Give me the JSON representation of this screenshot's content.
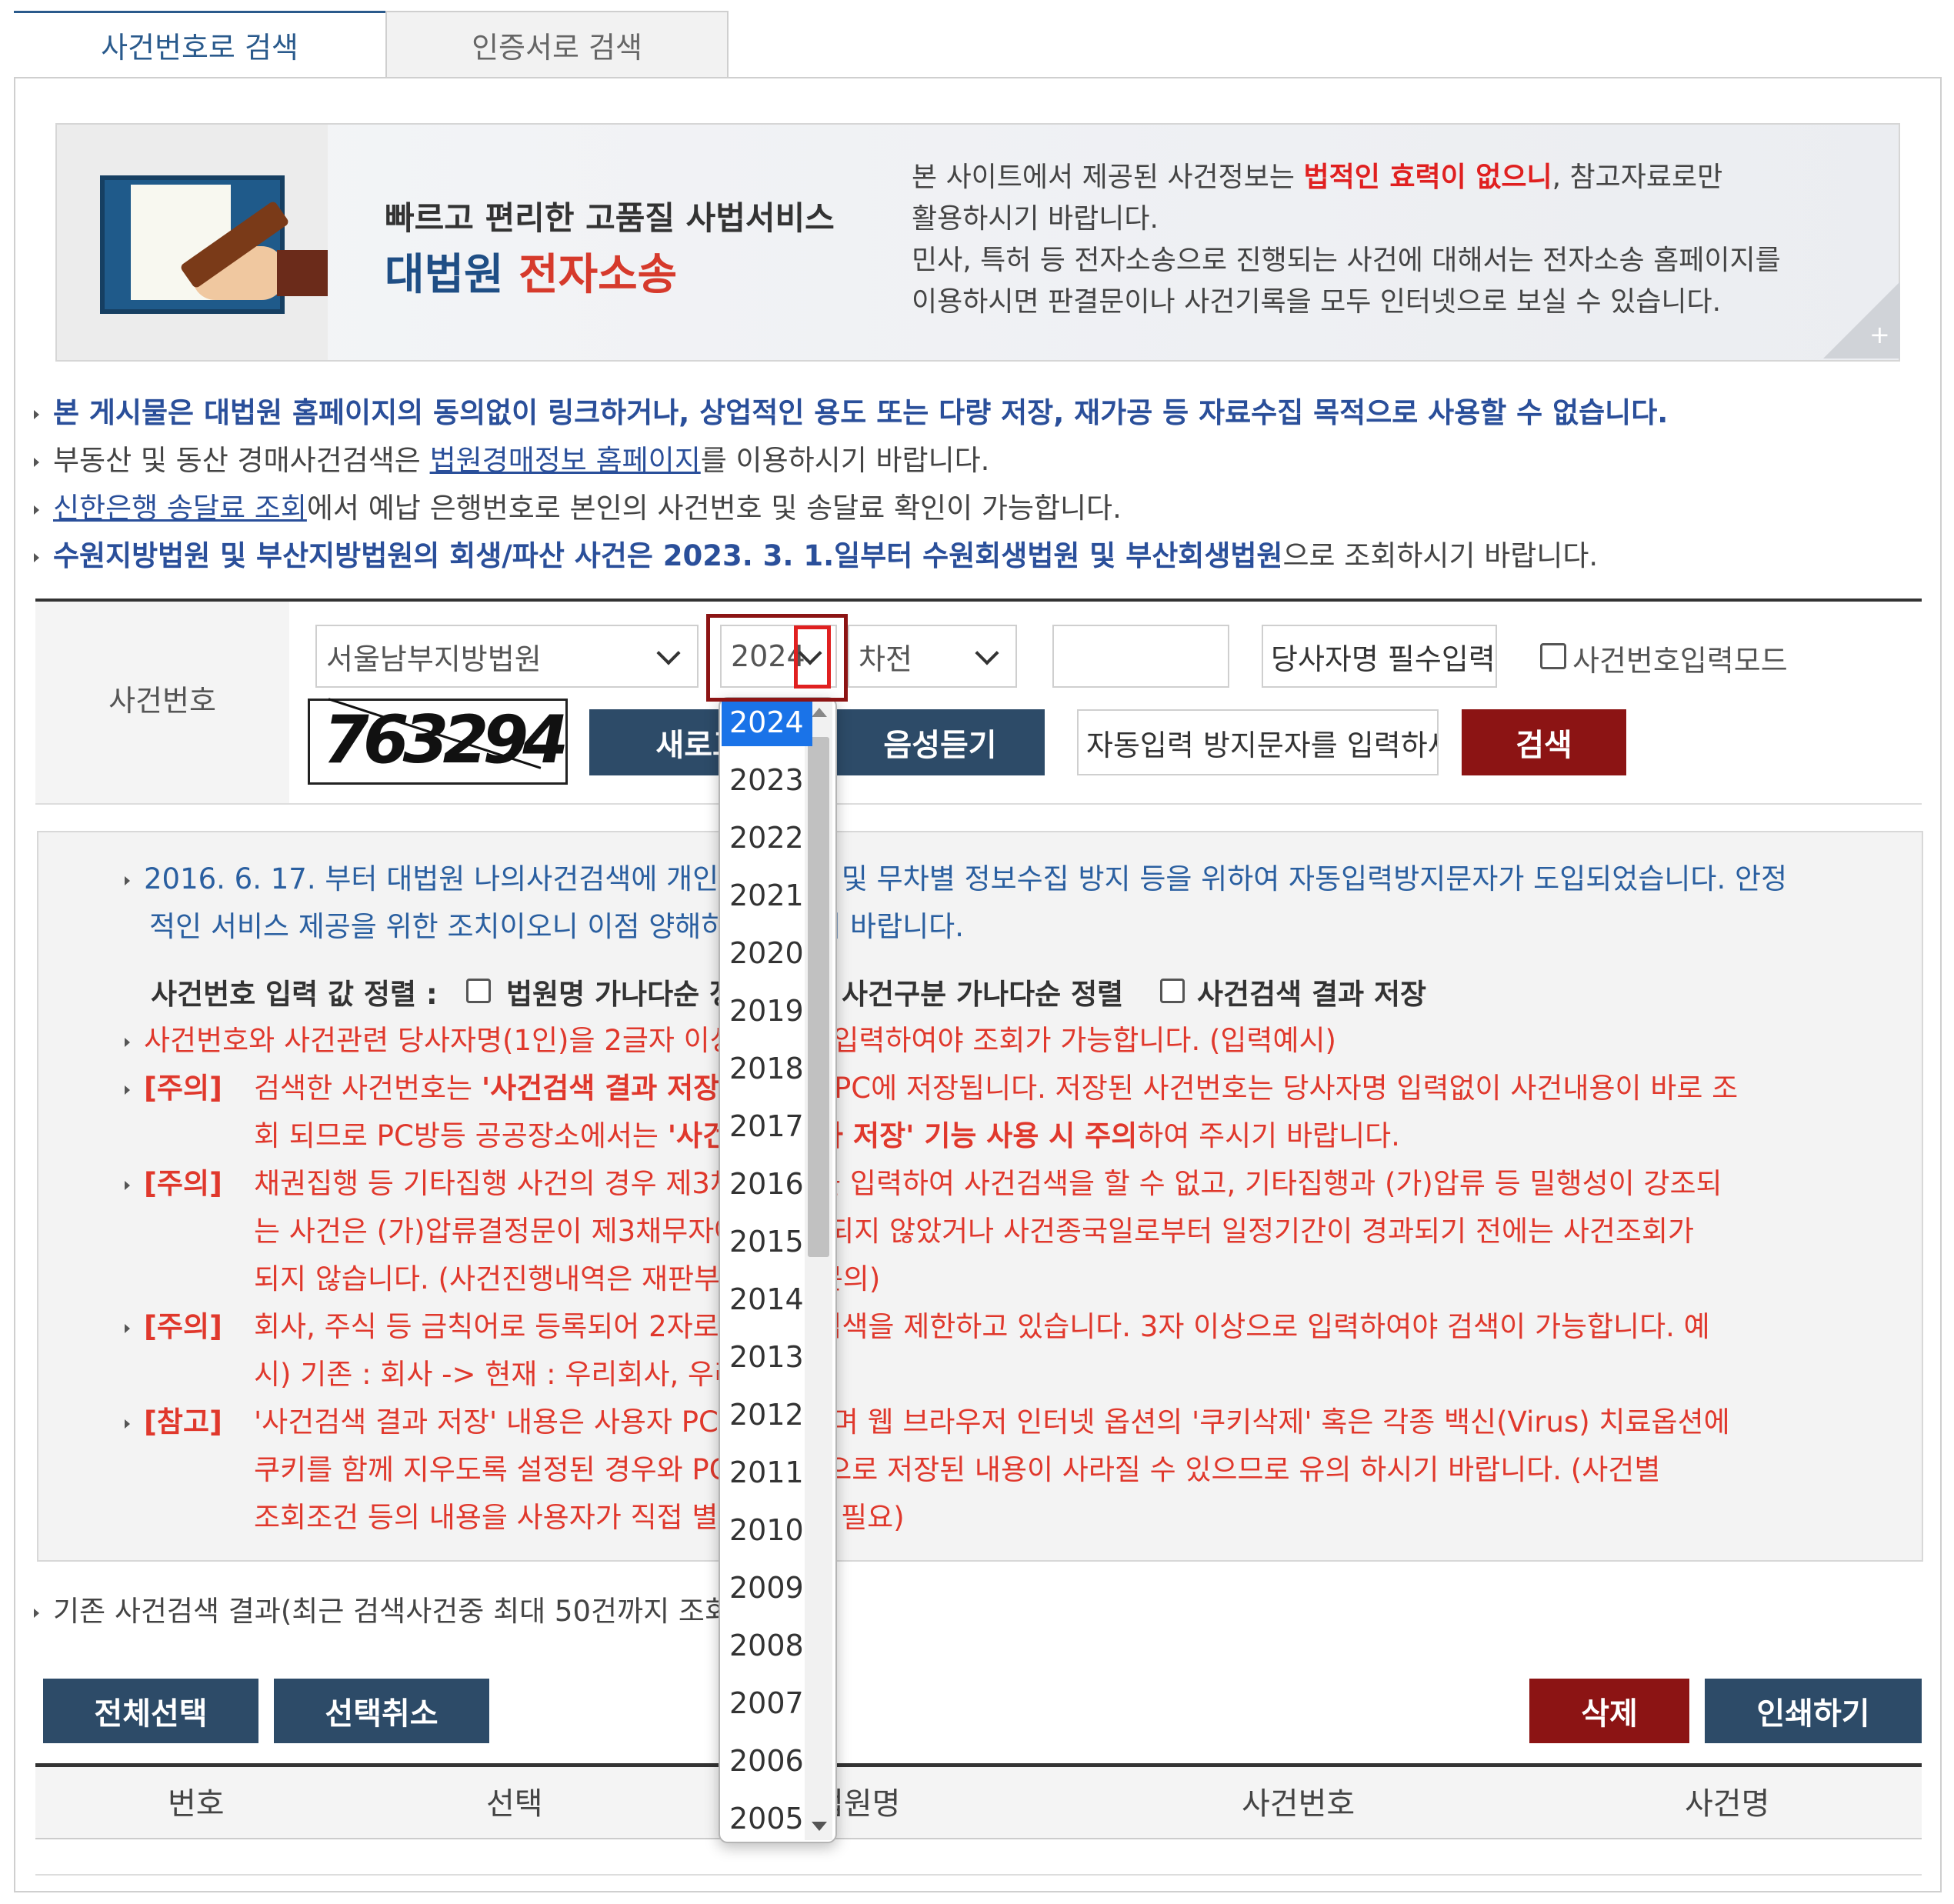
{
  "tabs": {
    "active": "사건번호로 검색",
    "inactive": "인증서로 검색"
  },
  "banner": {
    "title_line1": "빠르고 편리한 고품질 사법서비스",
    "title_main": "대법원",
    "title_red": "전자소송",
    "text_a": "본 사이트에서 제공된 사건정보는 ",
    "text_hl": "법적인 효력이 없으니",
    "text_b": ", 참고자료로만",
    "text_line2": "활용하시기 바랍니다.",
    "text_line3": "민사, 특허 등 전자소송으로 진행되는 사건에 대해서는 전자소송 홈페이지를",
    "text_line4": "이용하시면 판결문이나 사건기록을 모두 인터넷으로 보실 수 있습니다.",
    "plus": "+"
  },
  "notices": {
    "n1": "본 게시물은 대법원 홈페이지의 동의없이 링크하거나, 상업적인 용도 또는 다량 저장, 재가공 등 자료수집 목적으로 사용할 수 없습니다.",
    "n2_a": "부동산 및 동산 경매사건검색은 ",
    "n2_link": "법원경매정보 홈페이지",
    "n2_b": "를 이용하시기 바랍니다.",
    "n3_link": "신한은행 송달료 조회",
    "n3_b": "에서 예납 은행번호로 본인의 사건번호 및 송달료 확인이 가능합니다.",
    "n4_a": "수원지방법원 및 부산지방법원의 회생/파산 사건은 2023. 3. 1.일부터 수원회생법원 및 부산회생법원",
    "n4_b": "으로 조회하시기 바랍니다."
  },
  "search": {
    "label": "사건번호",
    "court": "서울남부지방법원",
    "year": "2024",
    "case_type": "차전",
    "case_number": "",
    "party_placeholder": "당사자명 필수입력",
    "input_mode_label": "사건번호입력모드",
    "captcha_text": "763294",
    "refresh_btn": "새로고침",
    "audio_btn": "음성듣기",
    "captcha_placeholder": "자동입력 방지문자를 입력하세요",
    "search_btn": "검색"
  },
  "year_options": [
    "2024",
    "2023",
    "2022",
    "2021",
    "2020",
    "2019",
    "2018",
    "2017",
    "2016",
    "2015",
    "2014",
    "2013",
    "2012",
    "2011",
    "2010",
    "2009",
    "2008",
    "2007",
    "2006",
    "2005"
  ],
  "info": {
    "l1": "2016. 6. 17. 부터 대법원 나의사건검색에 개인정보 보호 및 무차별 정보수집 방지 등을 위하여 자동입력방지문자가 도입되었습니다. 안정",
    "l2": "적인 서비스 제공을 위한 조치이오니 이점 양해하여 주시기 바랍니다.",
    "sort_label": "사건번호 입력 값 정렬 :",
    "sort_opt1": "법원명 가나다순 정렬",
    "sort_opt2": "사건구분 가나다순 정렬",
    "sort_opt3": "사건검색 결과 저장",
    "r1": "사건번호와 사건관련 당사자명(1인)을 2글자 이상 정확히 입력하여야 조회가 가능합니다. (입력예시)",
    "tag_caution": "[주의]",
    "tag_note": "[참고]",
    "c1_a": "검색한 사건번호는 ",
    "c1_b": "'사건검색 결과 저장'",
    "c1_c": " 선택 시 PC에 저장됩니다. 저장된 사건번호는 당사자명 입력없이 사건내용이 바로 조",
    "c1_d": "회 되므로 PC방등 공공장소에서는 ",
    "c1_e": "'사건검색 결과 저장' 기능 사용 시 주의",
    "c1_f": "하여 주시기 바랍니다.",
    "c2_a": "채권집행 등 기타집행 사건의 경우 제3채무자명을 입력하여 사건검색을 할 수 없고, 기타집행과 (가)압류 등 밀행성이 강조되",
    "c2_b": "는 사건은 (가)압류결정문이 제3채무자에게 송달되지 않았거나 사건종국일로부터 일정기간이 경과되기 전에는 사건조회가",
    "c2_c": "되지 않습니다. (사건진행내역은 재판부에 직접 문의)",
    "c3_a": "회사, 주식 등 금칙어로 등록되어 2자로 입력한 검색을 제한하고 있습니다. 3자 이상으로 입력하여야 검색이 가능합니다. 예",
    "c3_b": "시) 기존 : 회사 -> 현재 : 우리회사, 우리주식",
    "n1_a": "'사건검색 결과 저장' 내용은 사용자 PC에 저장되며 웹 브라우저 인터넷 옵션의 '쿠키삭제' 혹은 각종 백신(Virus) 치료옵션에",
    "n1_b": "쿠키를 함께 지우도록 설정된 경우와 PC 포맷 등으로 저장된 내용이 사라질 수 있으므로 유의 하시기 바랍니다. (사건별",
    "n1_c": "조회조건 등의 내용을 사용자가 직접 별도로 관리 필요)"
  },
  "results": {
    "caption": "기존 사건검색 결과(최근 검색사건중 최대 50건까지 조회)",
    "select_all": "전체선택",
    "deselect": "선택취소",
    "delete": "삭제",
    "print": "인쇄하기",
    "columns": [
      "번호",
      "선택",
      "법원명",
      "사건번호",
      "사건명"
    ]
  },
  "colors": {
    "navy": "#2d4b68",
    "dark_red": "#8c1414",
    "accent_blue": "#2a4f9a",
    "warn_red": "#e0382c"
  }
}
